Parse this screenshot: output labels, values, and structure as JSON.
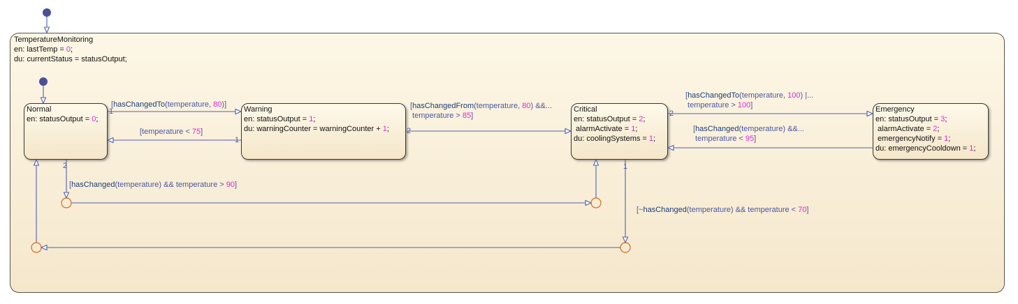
{
  "colors": {
    "state_border": "#3a372f",
    "transition": "#5360b0",
    "junction": "#d07020",
    "default_dot": "#4a4f9a",
    "number": "#d42ad0",
    "function": "#1c3d7a",
    "text": "#4a57a0"
  },
  "parent": {
    "lines": [
      [
        {
          "k": "t",
          "v": "TemperatureMonitoring"
        }
      ],
      [
        {
          "k": "t",
          "v": "en: lastTemp = "
        },
        {
          "k": "n",
          "v": "0"
        },
        {
          "k": "t",
          "v": ";"
        }
      ],
      [
        {
          "k": "t",
          "v": "du: currentStatus = statusOutput;"
        }
      ]
    ]
  },
  "states": [
    {
      "id": "normal",
      "lines": [
        [
          {
            "k": "t",
            "v": "Normal"
          }
        ],
        [
          {
            "k": "t",
            "v": "en: statusOutput = "
          },
          {
            "k": "n",
            "v": "0"
          },
          {
            "k": "t",
            "v": ";"
          }
        ]
      ]
    },
    {
      "id": "warning",
      "lines": [
        [
          {
            "k": "t",
            "v": "Warning"
          }
        ],
        [
          {
            "k": "t",
            "v": "en: statusOutput = "
          },
          {
            "k": "n",
            "v": "1"
          },
          {
            "k": "t",
            "v": ";"
          }
        ],
        [
          {
            "k": "t",
            "v": "du: warningCounter = warningCounter + "
          },
          {
            "k": "n",
            "v": "1"
          },
          {
            "k": "t",
            "v": ";"
          }
        ]
      ]
    },
    {
      "id": "critical",
      "lines": [
        [
          {
            "k": "t",
            "v": "Critical"
          }
        ],
        [
          {
            "k": "t",
            "v": "en: statusOutput = "
          },
          {
            "k": "n",
            "v": "2"
          },
          {
            "k": "t",
            "v": ";"
          }
        ],
        [
          {
            "k": "t",
            "v": " alarmActivate = "
          },
          {
            "k": "n",
            "v": "1"
          },
          {
            "k": "t",
            "v": ";"
          }
        ],
        [
          {
            "k": "t",
            "v": "du: coolingSystems = "
          },
          {
            "k": "n",
            "v": "1"
          },
          {
            "k": "t",
            "v": ";"
          }
        ]
      ]
    },
    {
      "id": "emergency",
      "lines": [
        [
          {
            "k": "t",
            "v": "Emergency"
          }
        ],
        [
          {
            "k": "t",
            "v": "en: statusOutput = "
          },
          {
            "k": "n",
            "v": "3"
          },
          {
            "k": "t",
            "v": ";"
          }
        ],
        [
          {
            "k": "t",
            "v": " alarmActivate = "
          },
          {
            "k": "n",
            "v": "2"
          },
          {
            "k": "t",
            "v": ";"
          }
        ],
        [
          {
            "k": "t",
            "v": " emergencyNotify = "
          },
          {
            "k": "n",
            "v": "1"
          },
          {
            "k": "t",
            "v": ";"
          }
        ],
        [
          {
            "k": "t",
            "v": "du: emergencyCooldown = "
          },
          {
            "k": "n",
            "v": "1"
          },
          {
            "k": "t",
            "v": ";"
          }
        ]
      ]
    }
  ],
  "transitions": [
    {
      "id": "normal-to-warning",
      "order": "1",
      "lines": [
        [
          {
            "k": "t",
            "v": "["
          },
          {
            "k": "f",
            "v": "hasChangedTo"
          },
          {
            "k": "t",
            "v": "(temperature, "
          },
          {
            "k": "n",
            "v": "80"
          },
          {
            "k": "t",
            "v": ")]"
          }
        ]
      ]
    },
    {
      "id": "warning-to-normal",
      "order": "1",
      "lines": [
        [
          {
            "k": "t",
            "v": "[temperature < "
          },
          {
            "k": "n",
            "v": "75"
          },
          {
            "k": "t",
            "v": "]"
          }
        ]
      ]
    },
    {
      "id": "warning-to-critical",
      "order": "2",
      "lines": [
        [
          {
            "k": "t",
            "v": "["
          },
          {
            "k": "f",
            "v": "hasChangedFrom"
          },
          {
            "k": "t",
            "v": "(temperature, "
          },
          {
            "k": "n",
            "v": "80"
          },
          {
            "k": "t",
            "v": ") &&..."
          }
        ],
        [
          {
            "k": "t",
            "v": " temperature > "
          },
          {
            "k": "n",
            "v": "85"
          },
          {
            "k": "t",
            "v": "]"
          }
        ]
      ]
    },
    {
      "id": "critical-to-emergency",
      "order": "2",
      "lines": [
        [
          {
            "k": "t",
            "v": "["
          },
          {
            "k": "f",
            "v": "hasChangedTo"
          },
          {
            "k": "t",
            "v": "(temperature, "
          },
          {
            "k": "n",
            "v": "100"
          },
          {
            "k": "t",
            "v": ") |..."
          }
        ],
        [
          {
            "k": "t",
            "v": " temperature > "
          },
          {
            "k": "n",
            "v": "100"
          },
          {
            "k": "t",
            "v": "]"
          }
        ]
      ]
    },
    {
      "id": "emergency-to-critical",
      "order": "",
      "lines": [
        [
          {
            "k": "t",
            "v": "["
          },
          {
            "k": "f",
            "v": "hasChanged"
          },
          {
            "k": "t",
            "v": "(temperature) &&..."
          }
        ],
        [
          {
            "k": "t",
            "v": " temperature < "
          },
          {
            "k": "n",
            "v": "95"
          },
          {
            "k": "t",
            "v": "]"
          }
        ]
      ]
    },
    {
      "id": "normal-to-junction",
      "order": "2",
      "lines": [
        [
          {
            "k": "t",
            "v": "["
          },
          {
            "k": "f",
            "v": "hasChanged"
          },
          {
            "k": "t",
            "v": "(temperature) && temperature > "
          },
          {
            "k": "n",
            "v": "90"
          },
          {
            "k": "t",
            "v": "]"
          }
        ]
      ]
    },
    {
      "id": "critical-to-junction",
      "order": "1",
      "lines": [
        [
          {
            "k": "t",
            "v": "[~"
          },
          {
            "k": "f",
            "v": "hasChanged"
          },
          {
            "k": "t",
            "v": "(temperature) && temperature < "
          },
          {
            "k": "n",
            "v": "70"
          },
          {
            "k": "t",
            "v": "]"
          }
        ]
      ]
    }
  ]
}
